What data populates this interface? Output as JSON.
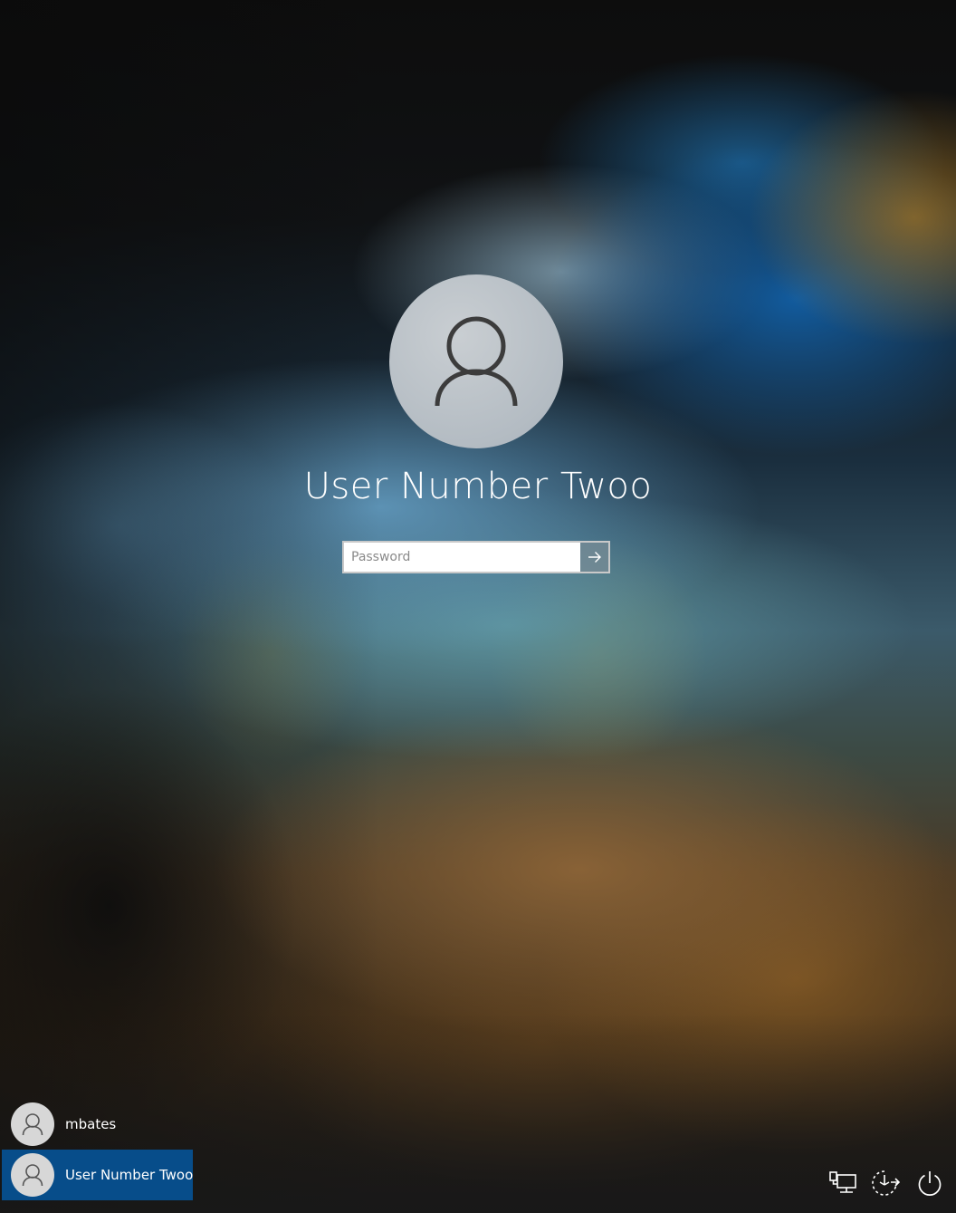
{
  "login": {
    "user_name": "User Number Twoo",
    "password_placeholder": "Password",
    "password_value": "",
    "submit_icon": "arrow-right-icon",
    "avatar_icon": "user-silhouette-icon"
  },
  "user_list": {
    "items": [
      {
        "label": "mbates",
        "icon": "user-silhouette-icon",
        "selected": false
      },
      {
        "label": "User Number Twoo",
        "icon": "user-silhouette-icon",
        "selected": true
      }
    ]
  },
  "system_tray": {
    "items": [
      {
        "name": "network",
        "icon": "network-icon"
      },
      {
        "name": "accessibility",
        "icon": "ease-of-access-icon"
      },
      {
        "name": "power",
        "icon": "power-icon"
      }
    ]
  },
  "colors": {
    "selected_user_background": "#074d8a",
    "text": "#ffffff",
    "avatar_background": "#d7d7d7"
  }
}
